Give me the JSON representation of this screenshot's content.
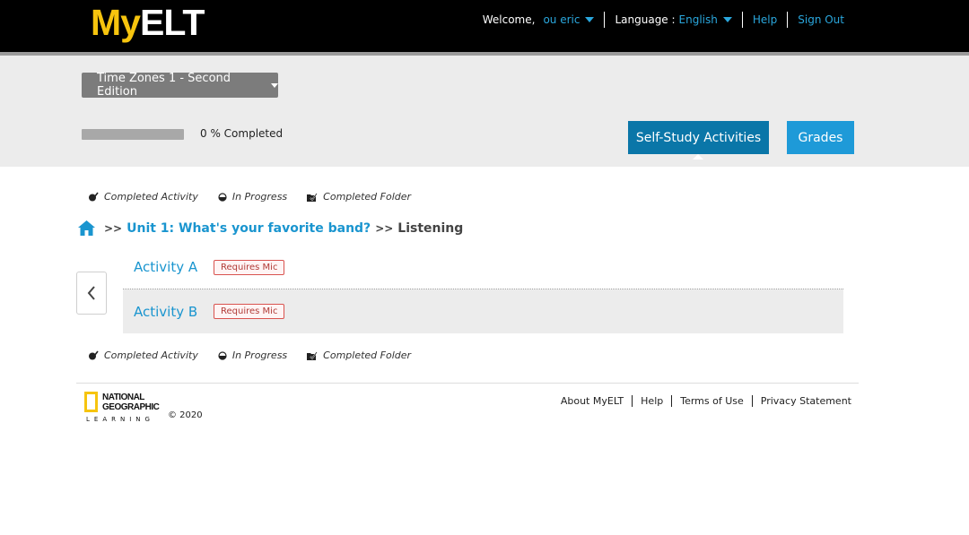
{
  "header": {
    "logo_my": "My",
    "logo_elt": "ELT",
    "welcome_label": "Welcome,",
    "user_name": "ou eric",
    "language_label": "Language :",
    "language_value": "English",
    "help": "Help",
    "sign_out": "Sign Out"
  },
  "course": {
    "selected": "Time Zones 1 - Second Edition",
    "progress_percent": 0,
    "progress_label": "0 %  Completed"
  },
  "tabs": {
    "self_study": "Self-Study Activities",
    "grades": "Grades"
  },
  "legend": {
    "completed_activity": "Completed Activity",
    "in_progress": "In Progress",
    "completed_folder": "Completed Folder"
  },
  "breadcrumb": {
    "separator": ">>",
    "unit": "Unit 1: What's your favorite band?",
    "current": "Listening"
  },
  "activities": [
    {
      "name": "Activity A",
      "badge": "Requires Mic"
    },
    {
      "name": "Activity B",
      "badge": "Requires Mic"
    }
  ],
  "footer": {
    "publisher_line1": "NATIONAL",
    "publisher_line2": "GEOGRAPHIC",
    "publisher_line3": "LEARNING",
    "copyright": "© 2020",
    "links": [
      "About MyELT",
      "Help",
      "Terms of Use",
      "Privacy Statement"
    ]
  },
  "colors": {
    "accent_blue": "#1a95cf",
    "logo_yellow": "#f6c40e",
    "active_tab": "#0a76a8",
    "mic_badge_red": "#d9534f"
  }
}
